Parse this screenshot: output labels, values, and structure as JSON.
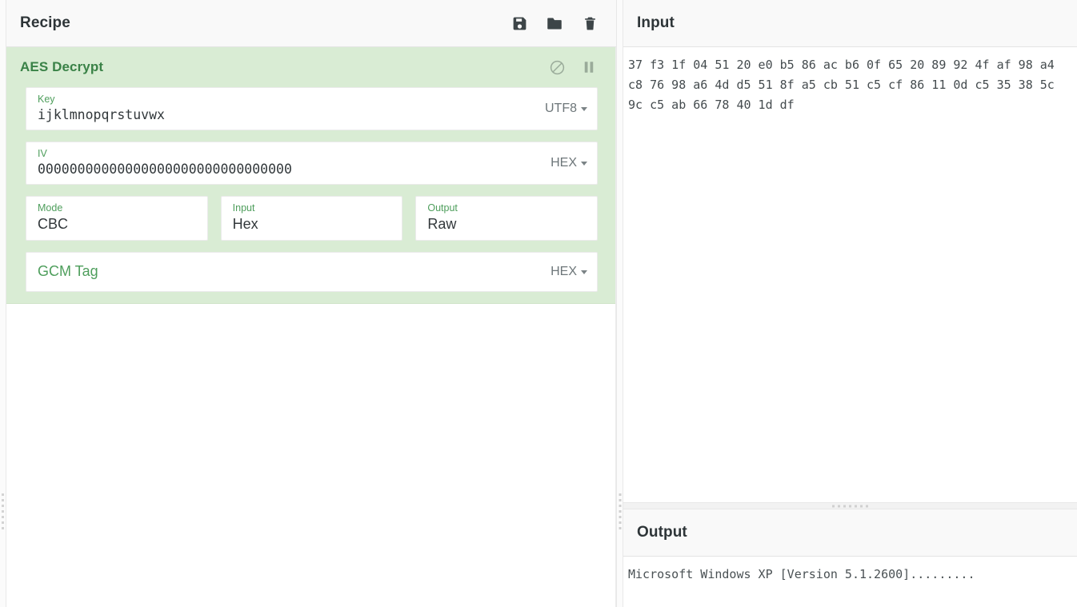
{
  "recipe": {
    "title": "Recipe",
    "controls": [
      {
        "name": "save-recipe",
        "icon": "save-icon",
        "label": "Save recipe"
      },
      {
        "name": "load-recipe",
        "icon": "folder-icon",
        "label": "Load recipe"
      },
      {
        "name": "clear-recipe",
        "icon": "trash-icon",
        "label": "Clear recipe"
      }
    ],
    "operation": {
      "name": "AES Decrypt",
      "disable_label": "Disable operation",
      "breakpoint_label": "Set breakpoint",
      "args": {
        "key": {
          "label": "Key",
          "value": "ijklmnopqrstuvwx",
          "encoding": "UTF8"
        },
        "iv": {
          "label": "IV",
          "value": "00000000000000000000000000000000",
          "encoding": "HEX"
        },
        "mode": {
          "label": "Mode",
          "value": "CBC"
        },
        "input": {
          "label": "Input",
          "value": "Hex"
        },
        "output": {
          "label": "Output",
          "value": "Raw"
        },
        "gcm_tag": {
          "label": "GCM Tag",
          "value": "",
          "encoding": "HEX"
        }
      }
    }
  },
  "input": {
    "title": "Input",
    "text": "37 f3 1f 04 51 20 e0 b5 86 ac b6 0f 65 20 89 92 4f af 98 a4 c8 76 98 a6 4d d5 51 8f a5 cb 51 c5 cf 86 11 0d c5 35 38 5c 9c c5 ab 66 78 40 1d df"
  },
  "output": {
    "title": "Output",
    "text": "Microsoft Windows XP [Version 5.1.2600]........."
  },
  "colors": {
    "operation_background": "#d9ecd4",
    "operation_title": "#3a8247",
    "field_label": "#4e9e5c",
    "pane_header_background": "#f9f9f9",
    "icon": "#3d4548"
  }
}
